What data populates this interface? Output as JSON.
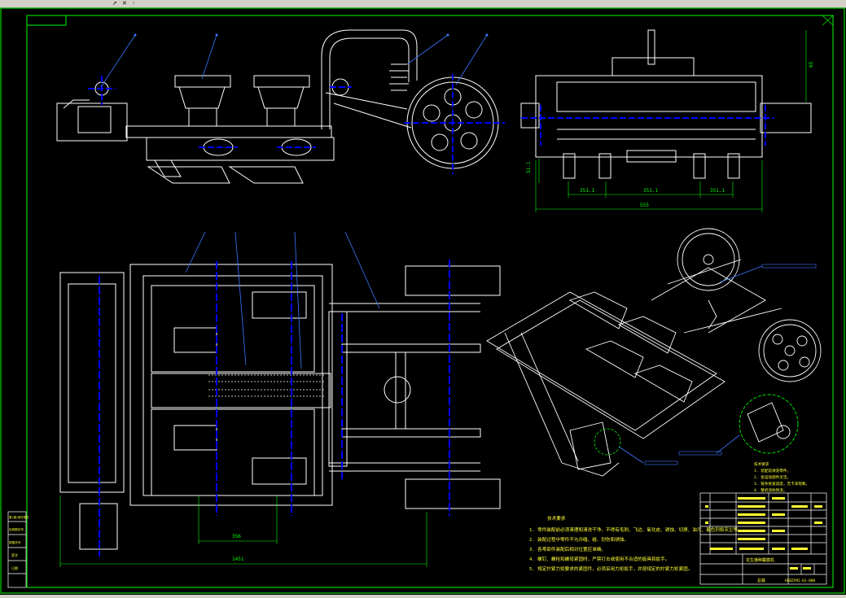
{
  "toolbar": {
    "icons": [
      "cursor-icon",
      "close-icon"
    ],
    "colors": {
      "bar": "#d4d0c8"
    }
  },
  "drawing": {
    "colors": {
      "background": "#000000",
      "frame": "#00ff00",
      "lines": "#ffffff",
      "centerlines": "#0000ff",
      "annotations": "#ffff33",
      "leaders": "#3c78ff"
    },
    "top_view_dims": {
      "d1": "356",
      "d2": "1451"
    },
    "side_view_dims": {
      "d1": "351.1",
      "d2": "351.1",
      "d3": "351.1",
      "total": "555",
      "height_left": "51.1",
      "height_right": "65"
    },
    "tech_req_title": "技术要求",
    "tech_req_lines": [
      "1. 零件装配前必须清理和清洗干净，不得有毛刺、飞边、氧化皮、锈蚀、切屑、油污、着色剂和灰尘等。",
      "2. 装配过程中零件不允许磕、碰、划伤和锈蚀。",
      "3. 各零部件装配后相对位置应准确。",
      "4. 螺钉、螺栓和螺母紧固时，严禁打击或使用不合适的旋具和扳手。",
      "5. 规定拧紧力矩要求的紧固件，必须采用力矩扳手，并按规定的拧紧力矩紧固。"
    ],
    "iso_notes_lines": [
      "技术要求",
      "1. 装配前清洗零件。",
      "2. 各运动部件灵活。",
      "3. 链条张紧适度，无卡滞现象。",
      "4. 整机涂防锈漆。"
    ],
    "title_block": {
      "title": "花生播种覆膜机",
      "sub": "总装",
      "code": "HSBZFMJ-01-000"
    },
    "left_strip_labels": [
      "借(通)用件登记",
      "旧底图总号",
      "底图总号",
      "签字",
      "日期"
    ]
  }
}
